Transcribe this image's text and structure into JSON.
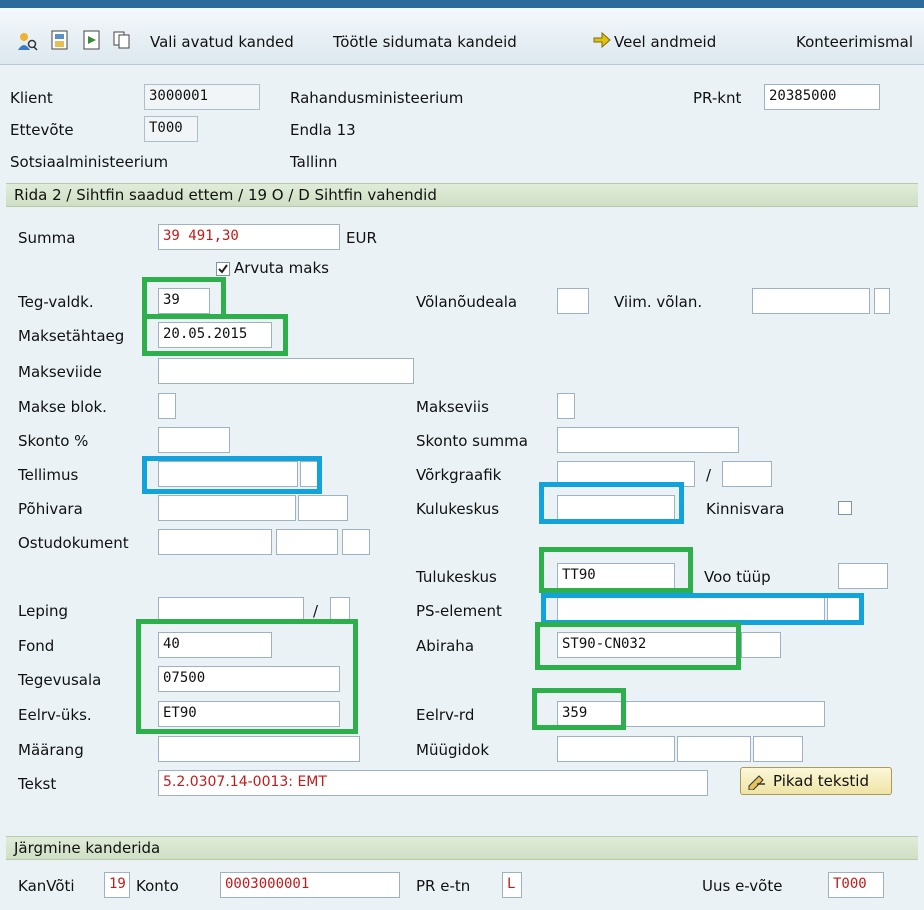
{
  "toolbar": {
    "items": [
      "Vali avatud kanded",
      "Töötle sidumata kandeid",
      "Veel andmeid",
      "Konteerimismal"
    ]
  },
  "header": {
    "klient_label": "Klient",
    "klient_value": "3000001",
    "klient_name": "Rahandusministeerium",
    "prknt_label": "PR-knt",
    "prknt_value": "20385000",
    "ettevote_label": "Ettevõte",
    "ettevote_value": "T000",
    "address1": "Endla 13",
    "org": "Sotsiaalministeerium",
    "city": "Tallinn"
  },
  "section1": {
    "title": "Rida 2 / Sihtfin saadud ettem / 19 O / D Sihtfin vahendid",
    "summa_label": "Summa",
    "summa_value": "39 491,30",
    "currency": "EUR",
    "arvuta_label": "Arvuta maks",
    "teg_valdk_label": "Teg-valdk.",
    "teg_valdk_value": "39",
    "volanoudeala_label": "Võlanõudeala",
    "viim_volan_label": "Viim. võlan.",
    "maksetahtaeg_label": "Maksetähtaeg",
    "maksetahtaeg_value": "20.05.2015",
    "makseviide_label": "Makseviide",
    "makse_blok_label": "Makse blok.",
    "makseviis_label": "Makseviis",
    "skonto_label": "Skonto %",
    "skonto_summa_label": "Skonto summa",
    "tellimus_label": "Tellimus",
    "vorkgraafik_label": "Võrkgraafik",
    "pohivara_label": "Põhivara",
    "kulukeskus_label": "Kulukeskus",
    "kinnisvara_label": "Kinnisvara",
    "ostudokument_label": "Ostudokument",
    "tulukeskus_label": "Tulukeskus",
    "tulukeskus_value": "TT90",
    "voo_tuup_label": "Voo tüüp",
    "leping_label": "Leping",
    "ps_element_label": "PS-element",
    "fond_label": "Fond",
    "fond_value": "40",
    "abiraha_label": "Abiraha",
    "abiraha_value": "ST90-CN032",
    "tegevusala_label": "Tegevusala",
    "tegevusala_value": "07500",
    "eelrv_uks_label": "Eelrv-üks.",
    "eelrv_uks_value": "ET90",
    "eelrv_rd_label": "Eelrv-rd",
    "eelrv_rd_value": "359",
    "maarang_label": "Määrang",
    "muugidok_label": "Müügidok",
    "tekst_label": "Tekst",
    "tekst_value": "5.2.0307.14-0013: EMT",
    "pikad_label": "Pikad tekstid"
  },
  "section2": {
    "title": "Järgmine kanderida",
    "kanvoti_label": "KanVõti",
    "kanvoti_value": "19",
    "konto_label": "Konto",
    "konto_value": "0003000001",
    "pretn_label": "PR e-tn",
    "pretn_value": "L",
    "uus_label": "Uus e-võte",
    "uus_value": "T000"
  },
  "colors": {
    "highlight_green": "#2db04b",
    "highlight_blue": "#12a2dc",
    "required_text": "#c21b1b"
  }
}
